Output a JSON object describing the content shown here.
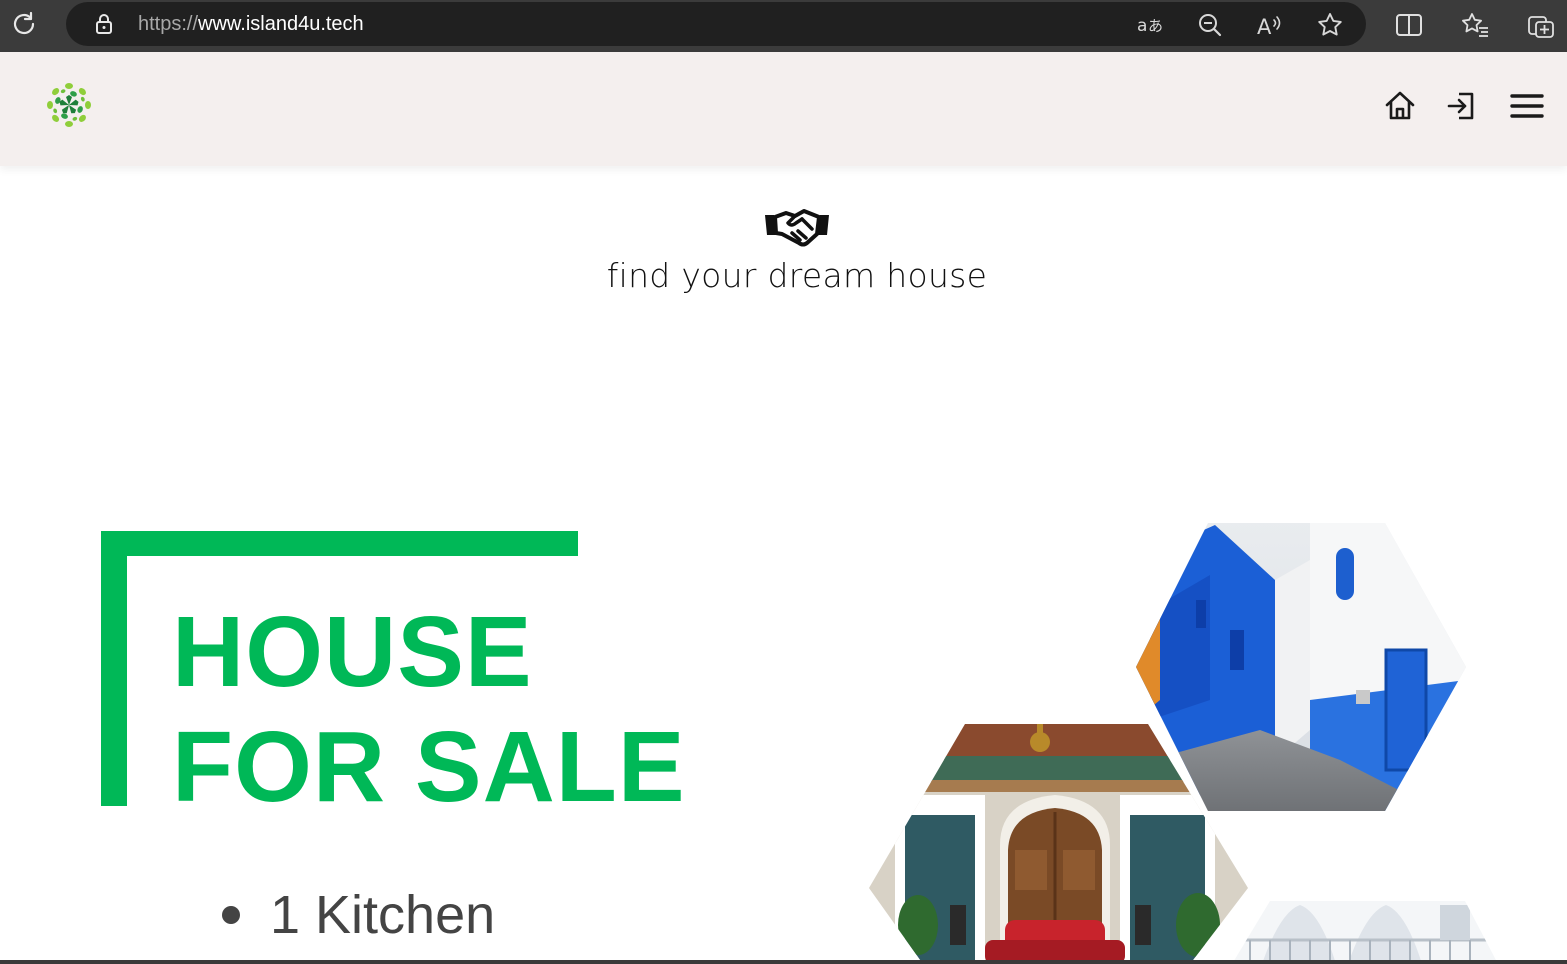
{
  "browser": {
    "url_scheme": "https://",
    "url_host": "www.island4u.tech"
  },
  "icons": {
    "reload": "reload-icon",
    "lock": "lock-icon",
    "translate": "translate-icon",
    "zoom_out": "zoom-out-icon",
    "read_aloud": "read-aloud-icon",
    "favorite": "star-icon",
    "split_screen": "split-screen-icon",
    "favorites_list": "favorites-icon",
    "collections": "collections-icon",
    "site_logo": "leaf-logo-icon",
    "home": "home-icon",
    "login": "sign-in-icon",
    "menu": "hamburger-menu-icon",
    "handshake": "handshake-icon"
  },
  "hero": {
    "title": "find your dream house"
  },
  "sale_banner": {
    "line_1": "HOUSE",
    "line_2": "FOR SALE",
    "features": [
      "1 Kitchen"
    ]
  },
  "colors": {
    "brand_green": "#00b857",
    "header_bg": "#f4efee",
    "browser_bar": "#3b3b3b",
    "address_bg": "#202020"
  }
}
